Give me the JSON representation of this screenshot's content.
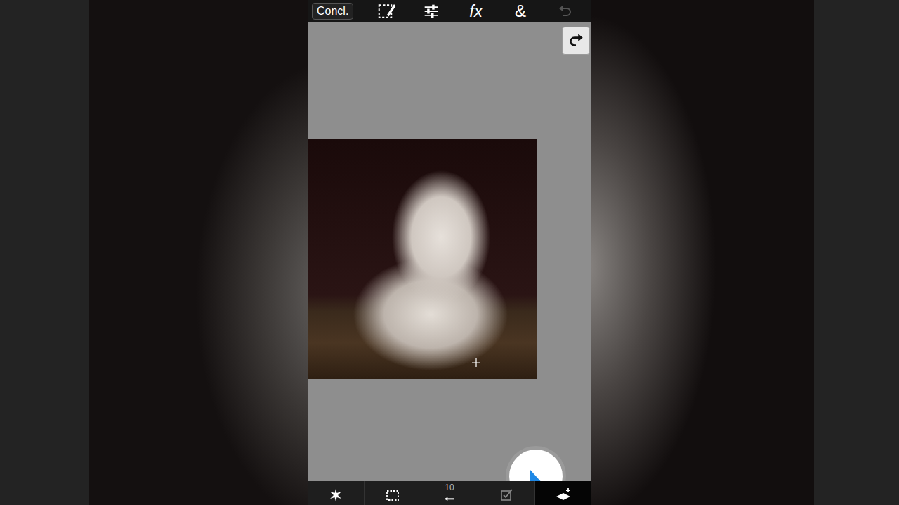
{
  "toolbar": {
    "done": "Concl.",
    "fx": "fx",
    "blend": "&",
    "undo_disabled": true
  },
  "bottom_tools": [
    {
      "kind": "magic",
      "selected": false
    },
    {
      "kind": "marquee",
      "selected": false
    },
    {
      "kind": "brush",
      "selected": false,
      "label": "10"
    },
    {
      "kind": "check",
      "selected": false
    },
    {
      "kind": "addlayer",
      "selected": true
    }
  ]
}
